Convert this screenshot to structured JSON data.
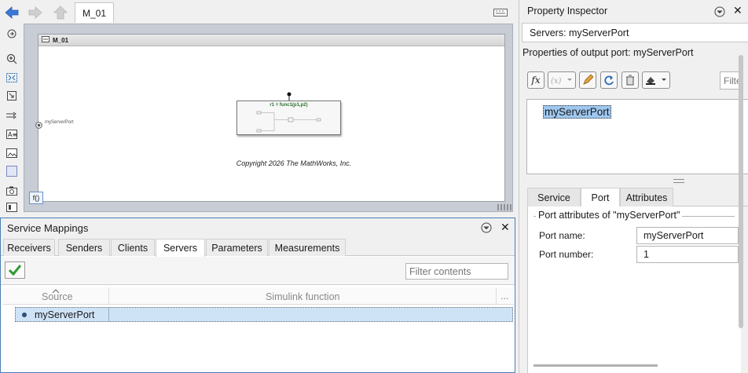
{
  "nav": {
    "model_tab": "M_01"
  },
  "canvas": {
    "model_title": "M_01",
    "function_label": "r1 = func1(p1,p2)",
    "copyright": "Copyright 2026 The MathWorks, Inc.",
    "port_label": "myServerPort",
    "fx_label": "f()"
  },
  "service_mappings": {
    "title": "Service Mappings",
    "tabs": [
      "Receivers",
      "Senders",
      "Clients",
      "Servers",
      "Parameters",
      "Measurements"
    ],
    "active_tab": "Servers",
    "filter_placeholder": "Filter contents",
    "columns": [
      "Source",
      "Simulink function"
    ],
    "more_glyph": "...",
    "rows": [
      {
        "source": "myServerPort",
        "function": ""
      }
    ]
  },
  "inspector": {
    "title": "Property Inspector",
    "breadcrumb": "Servers: myServerPort",
    "properties_title": "Properties of output port: myServerPort",
    "fx_label": "fx",
    "filter_placeholder": "Filter",
    "name_value": "myServerPort",
    "tabs": [
      "Service",
      "Port",
      "Attributes"
    ],
    "active_tab": "Port",
    "group_title": "Port attributes of \"myServerPort\"",
    "port_name_label": "Port name:",
    "port_name_value": "myServerPort",
    "port_number_label": "Port number:",
    "port_number_value": "1"
  },
  "colors": {
    "accent_blue": "#4a7fb5",
    "selection": "#cfe3f7",
    "function_green": "#2a6e2a"
  }
}
